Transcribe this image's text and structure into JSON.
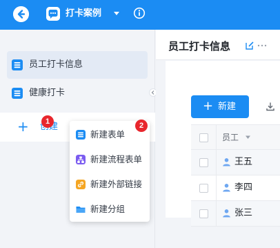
{
  "topbar": {
    "back_icon": "back-arrow-icon",
    "app_icon": "chat-bubble-icon",
    "app_title": "打卡案例",
    "caret_icon": "caret-down-icon",
    "info_icon": "info-icon",
    "bg_color": "#1b8cf3"
  },
  "sidebar": {
    "items": [
      {
        "label": "员工打卡信息",
        "icon": "form-icon",
        "active": true
      },
      {
        "label": "健康打卡",
        "icon": "form-icon",
        "active": false
      }
    ],
    "create_label": "创建",
    "badge_1": "1",
    "badge_2": "2"
  },
  "menu": {
    "items": [
      {
        "label": "新建表单",
        "icon": "form-icon",
        "color": "#1b8cf3"
      },
      {
        "label": "新建流程表单",
        "icon": "flow-icon",
        "color": "#7b5cf0"
      },
      {
        "label": "新建外部链接",
        "icon": "link-icon",
        "color": "#f5a623"
      },
      {
        "label": "新建分组",
        "icon": "folder-icon",
        "color": "#1b8cf3"
      }
    ]
  },
  "main": {
    "title": "员工打卡信息",
    "edit_icon": "edit-icon",
    "more_icon": "more-icon",
    "new_button_label": "新建",
    "download_icon": "download-icon",
    "table": {
      "header": "员工",
      "rows": [
        "王五",
        "李四",
        "张三"
      ]
    }
  },
  "accent": "#1b8cf3",
  "badge_color": "#e8262d"
}
